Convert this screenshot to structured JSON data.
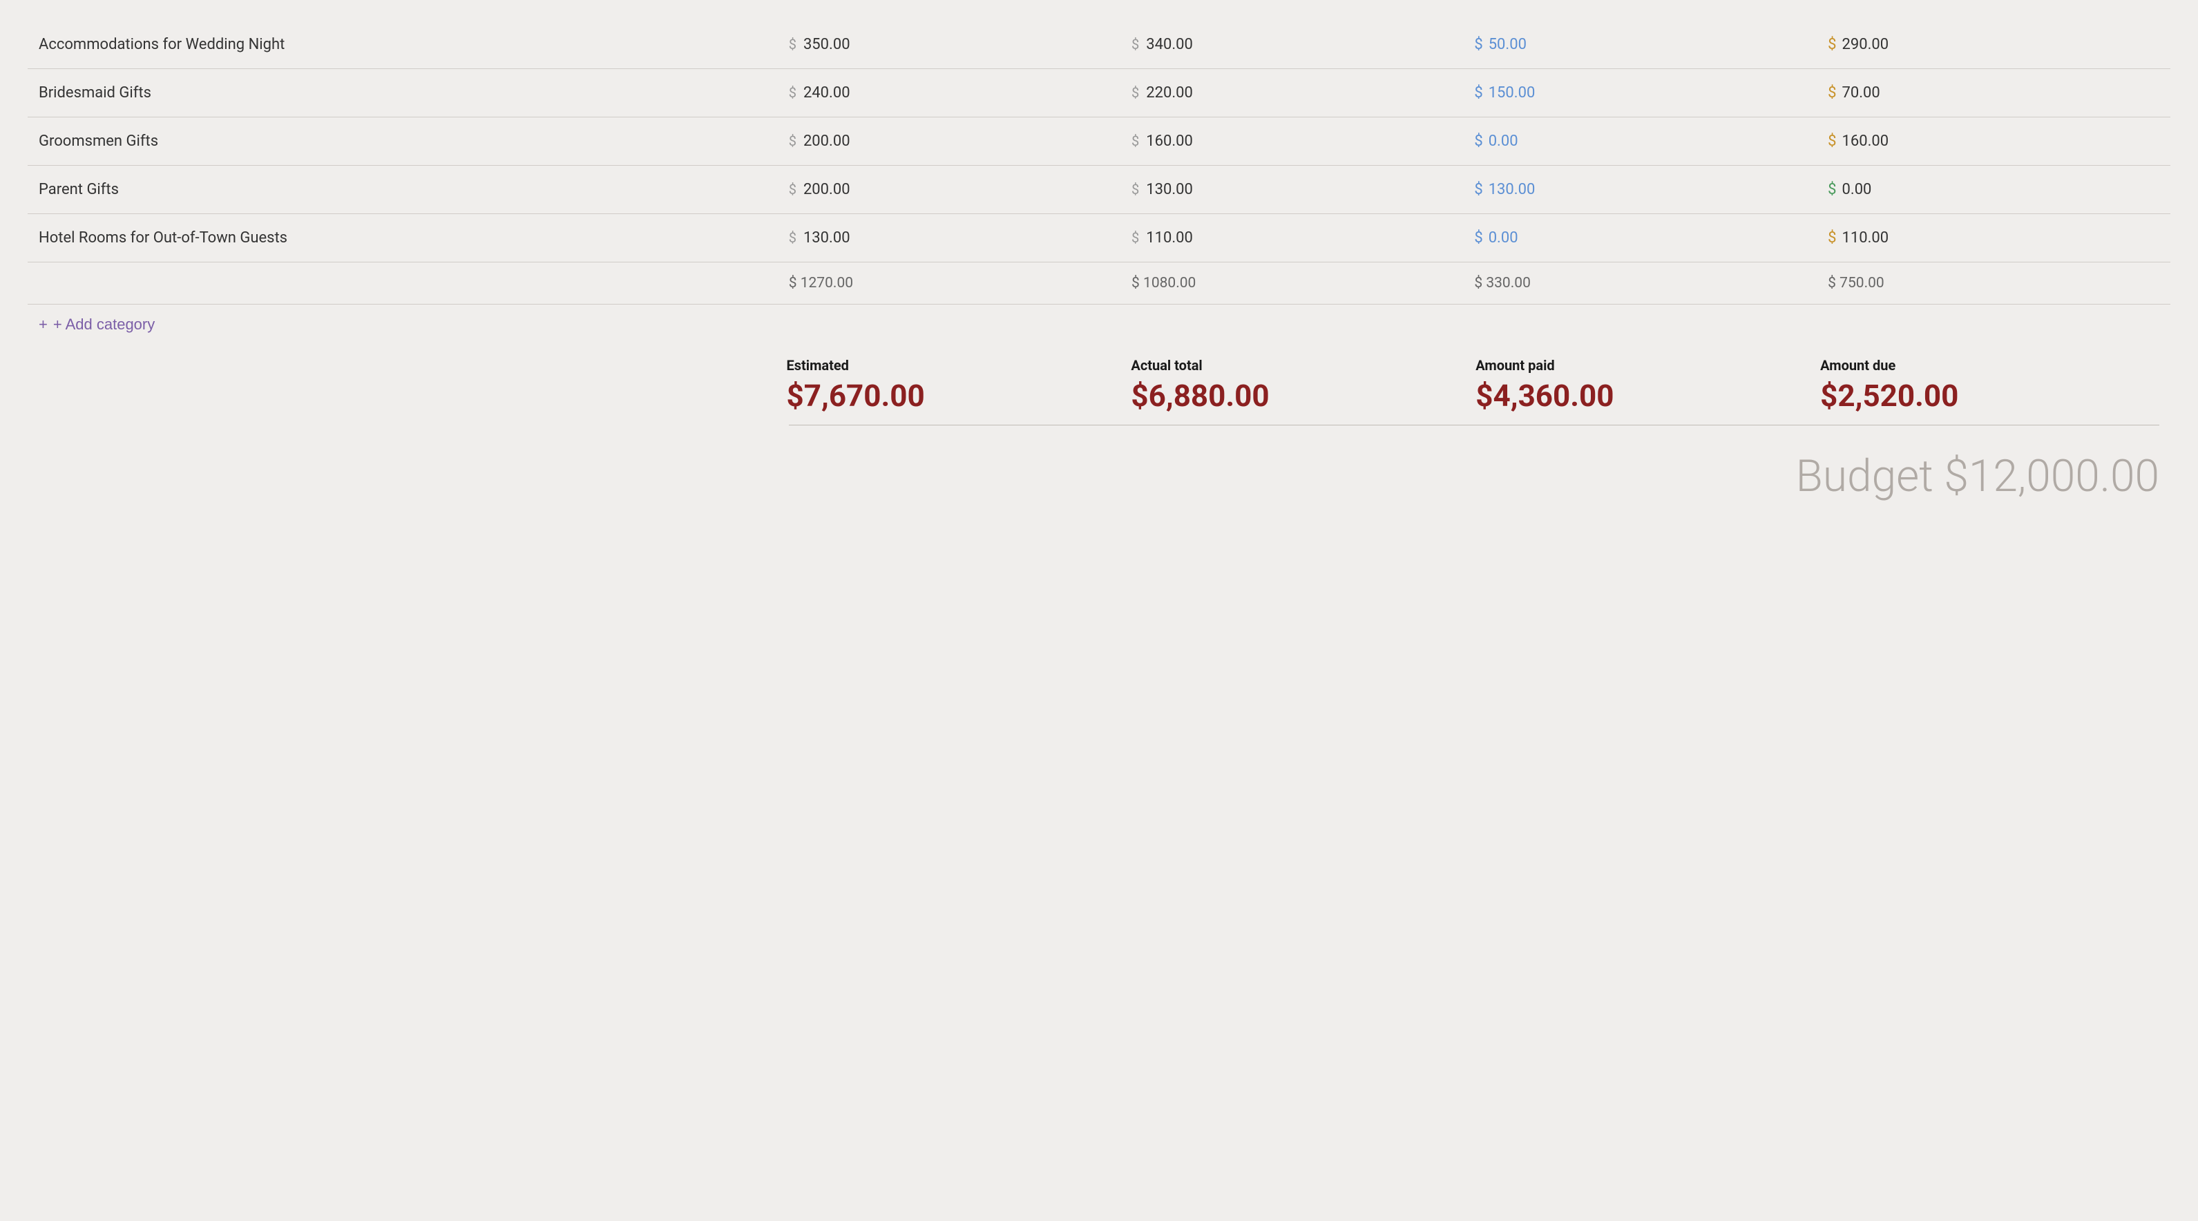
{
  "table": {
    "rows": [
      {
        "name": "Accommodations for Wedding Night",
        "estimated": "350.00",
        "actual": "340.00",
        "paid": "50.00",
        "due": "290.00",
        "due_color": "orange"
      },
      {
        "name": "Bridesmaid Gifts",
        "estimated": "240.00",
        "actual": "220.00",
        "paid": "150.00",
        "due": "70.00",
        "due_color": "orange"
      },
      {
        "name": "Groomsmen Gifts",
        "estimated": "200.00",
        "actual": "160.00",
        "paid": "0.00",
        "due": "160.00",
        "due_color": "orange"
      },
      {
        "name": "Parent Gifts",
        "estimated": "200.00",
        "actual": "130.00",
        "paid": "130.00",
        "due": "0.00",
        "due_color": "green"
      },
      {
        "name": "Hotel Rooms for Out-of-Town Guests",
        "estimated": "130.00",
        "actual": "110.00",
        "paid": "0.00",
        "due": "110.00",
        "due_color": "orange"
      }
    ],
    "totals": {
      "estimated": "$ 1270.00",
      "actual": "$ 1080.00",
      "paid": "$ 330.00",
      "due": "$ 750.00"
    },
    "add_category_label": "+ Add category"
  },
  "summary": {
    "estimated_label": "Estimated",
    "estimated_value": "$7,670.00",
    "actual_label": "Actual total",
    "actual_value": "$6,880.00",
    "paid_label": "Amount paid",
    "paid_value": "$4,360.00",
    "due_label": "Amount due",
    "due_value": "$2,520.00"
  },
  "budget": {
    "label": "Budget",
    "value": "$12,000.00"
  },
  "colors": {
    "blue": "#5b8fd4",
    "orange": "#c8922a",
    "green": "#4a9a5c",
    "purple": "#7b5ea7",
    "dark_red": "#8b2020",
    "gray": "#b0aaa5"
  }
}
